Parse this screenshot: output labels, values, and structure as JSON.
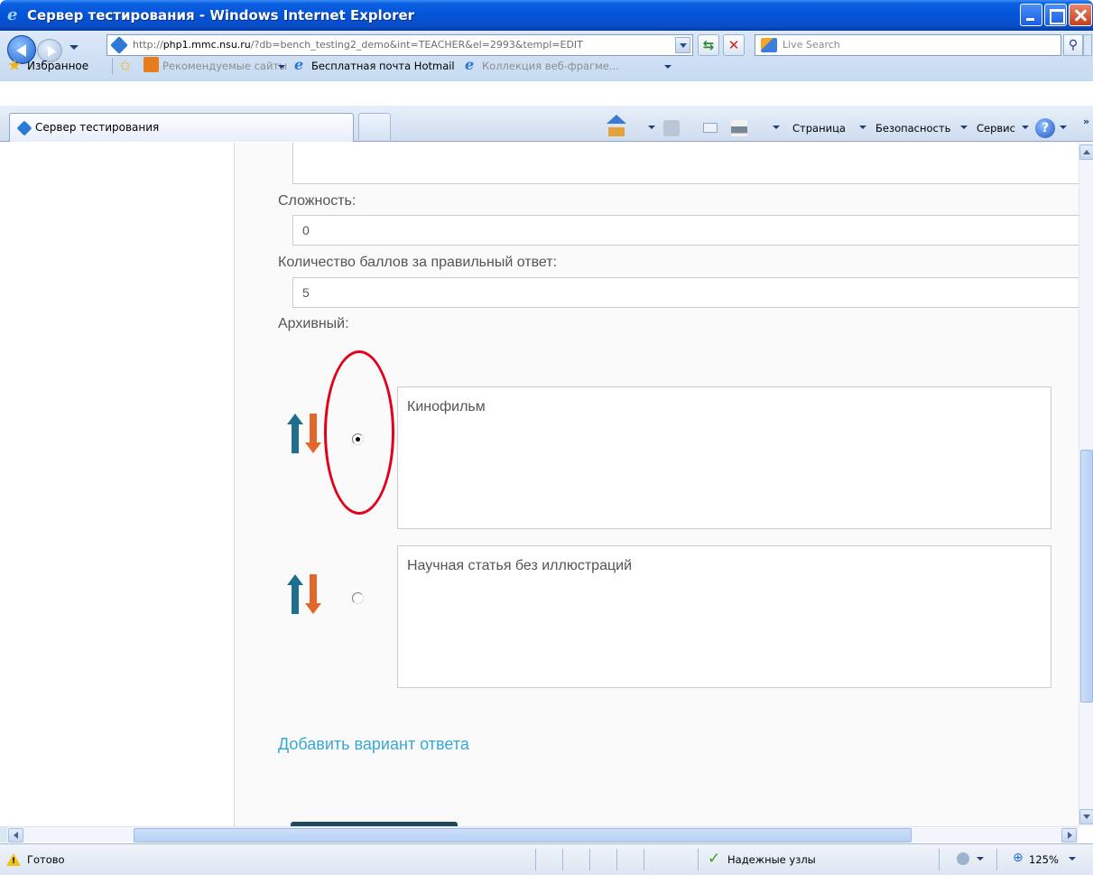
{
  "window": {
    "title": "Сервер тестирования - Windows Internet Explorer"
  },
  "address_bar": {
    "url_prefix": "http://",
    "url_host": "php1.mmc.nsu.ru",
    "url_rest": "/?db=bench_testing2_demo&int=TEACHER&el=2993&templ=EDIT",
    "search_placeholder": "Live Search"
  },
  "favorites_bar": {
    "favorites_label": "Избранное",
    "items": [
      {
        "label": "Рекомендуемые сайты",
        "icon": "orange-square-icon"
      },
      {
        "label": "Бесплатная почта Hotmail",
        "icon": "ie-icon"
      },
      {
        "label": "Коллекция веб-фрагме...",
        "icon": "ie-icon"
      }
    ]
  },
  "tab_bar": {
    "active_tab_label": "Сервер тестирования",
    "commands": {
      "page": "Страница",
      "safety": "Безопасность",
      "tools": "Сервис"
    }
  },
  "form": {
    "difficulty_label": "Сложность:",
    "difficulty_value": "0",
    "points_label": "Количество баллов за правильный ответ:",
    "points_value": "5",
    "archive_label": "Архивный:",
    "answers": [
      {
        "text": "Кинофильм",
        "selected": true
      },
      {
        "text": "Научная статья без иллюстраций",
        "selected": false
      }
    ],
    "add_answer_link": "Добавить вариант ответа"
  },
  "status_bar": {
    "status_text": "Готово",
    "zone_text": "Надежные узлы",
    "zoom_text": "125%"
  },
  "colors": {
    "link": "#3aa7d6",
    "highlight_ellipse": "#e2001a",
    "sort_up_arrow": "#1e6f8e",
    "sort_down_arrow": "#e2672a"
  }
}
